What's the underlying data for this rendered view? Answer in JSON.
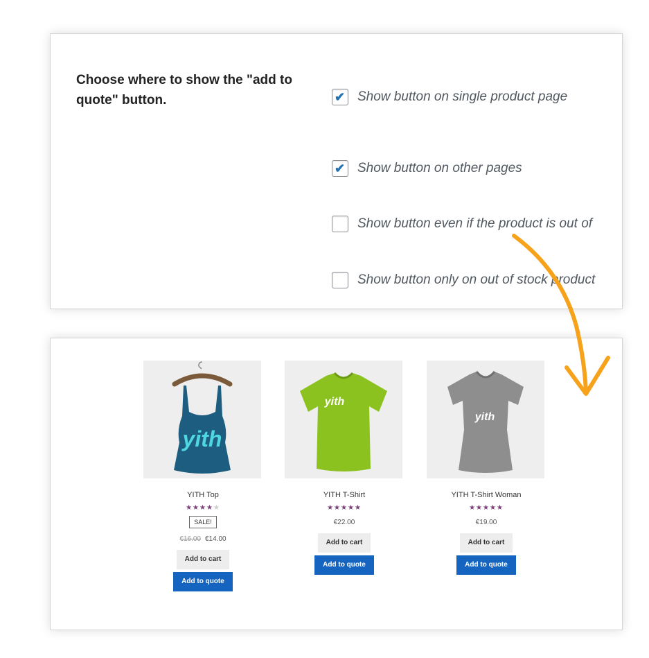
{
  "settings": {
    "heading": "Choose where to show the \"add to quote\" button.",
    "options": [
      {
        "label": "Show button on single product page",
        "checked": true
      },
      {
        "label": "Show button on other pages",
        "checked": true
      },
      {
        "label": "Show button even if the product is out of",
        "checked": false
      },
      {
        "label": "Show button only on out of stock product",
        "checked": false
      }
    ],
    "check_glyph": "✔"
  },
  "shop": {
    "products": [
      {
        "name": "YITH Top",
        "stars": "★★★★",
        "stars_empty": "★",
        "sale_badge": "SALE!",
        "old_price": "€16.00",
        "price": "€14.00",
        "cart_label": "Add to cart",
        "quote_label": "Add to quote",
        "shirt_color": "#1d5e80",
        "logo_color": "#4fd6e0",
        "logo_text": "yith",
        "style": "tank"
      },
      {
        "name": "YITH T-Shirt",
        "stars": "★★★★★",
        "stars_empty": "",
        "price": "€22.00",
        "cart_label": "Add to cart",
        "quote_label": "Add to quote",
        "shirt_color": "#8cc21f",
        "logo_color": "#ffffff",
        "logo_text": "yith",
        "style": "tee"
      },
      {
        "name": "YITH T-Shirt Woman",
        "stars": "★★★★★",
        "stars_empty": "",
        "price": "€19.00",
        "cart_label": "Add to cart",
        "quote_label": "Add to quote",
        "shirt_color": "#8e8e8e",
        "logo_color": "#ffffff",
        "logo_text": "yith",
        "style": "tee-woman"
      }
    ]
  },
  "colors": {
    "accent_check": "#2271b1",
    "quote_button": "#1565c0",
    "arrow": "#f7a21b",
    "star": "#7b3f7a"
  }
}
